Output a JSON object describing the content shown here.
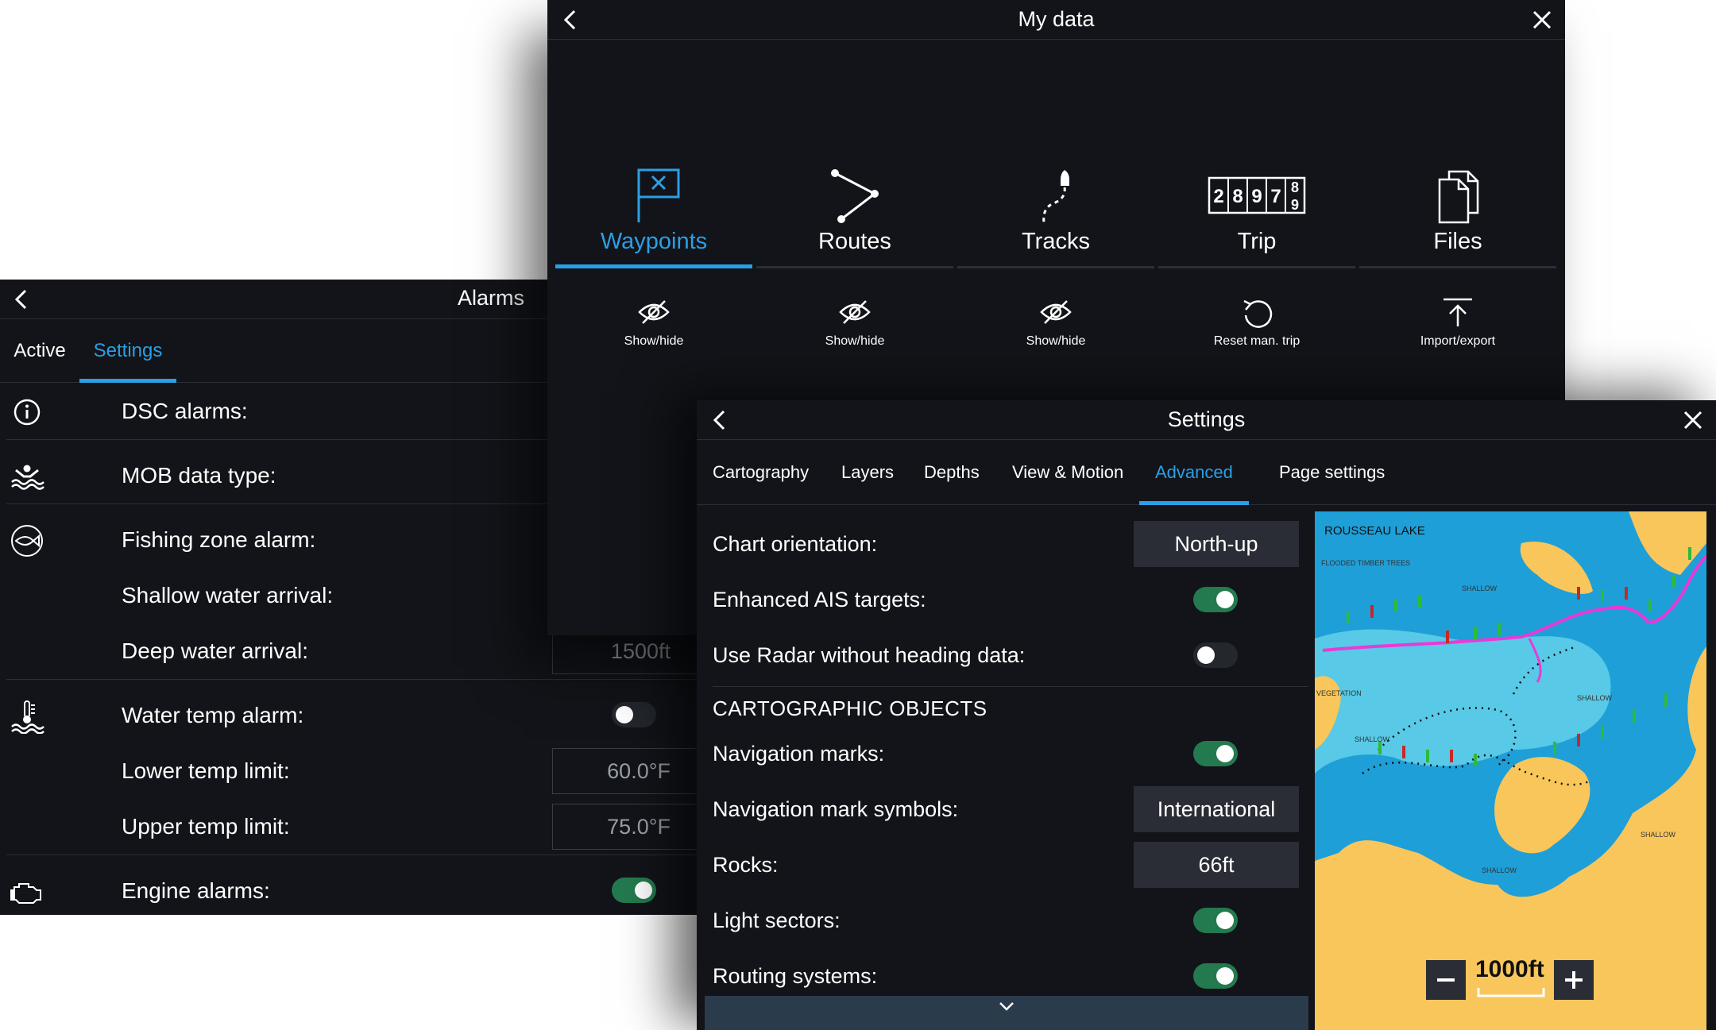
{
  "alarms": {
    "title": "Alarms",
    "tabs": [
      {
        "label": "Active"
      },
      {
        "label": "Settings"
      }
    ],
    "rows": {
      "dsc": "DSC alarms:",
      "mob": "MOB data type:",
      "fishing": "Fishing zone alarm:",
      "shallow": "Shallow water arrival:",
      "deep": "Deep water arrival:",
      "deep_value": "1500ft",
      "water_temp": "Water temp alarm:",
      "lower": "Lower temp limit:",
      "lower_value": "60.0°F",
      "upper": "Upper temp limit:",
      "upper_value": "75.0°F",
      "engine": "Engine alarms:"
    },
    "toggles": {
      "water_temp": false,
      "engine": true
    }
  },
  "mydata": {
    "title": "My data",
    "tabs": [
      {
        "label": "Waypoints",
        "icon": "waypoint-flag-icon"
      },
      {
        "label": "Routes",
        "icon": "route-icon"
      },
      {
        "label": "Tracks",
        "icon": "track-icon"
      },
      {
        "label": "Trip",
        "icon": "trip-counter-icon"
      },
      {
        "label": "Files",
        "icon": "files-icon"
      }
    ],
    "trip_digits": [
      "2",
      "8",
      "9",
      "7",
      "8",
      "9"
    ],
    "actions": [
      {
        "label": "Show/hide",
        "icon": "eye-hidden-icon"
      },
      {
        "label": "Show/hide",
        "icon": "eye-hidden-icon"
      },
      {
        "label": "Show/hide",
        "icon": "eye-hidden-icon"
      },
      {
        "label": "Reset man. trip",
        "icon": "reset-icon"
      },
      {
        "label": "Import/export",
        "icon": "upload-icon"
      }
    ]
  },
  "settings": {
    "title": "Settings",
    "tabs": [
      {
        "label": "Cartography"
      },
      {
        "label": "Layers"
      },
      {
        "label": "Depths"
      },
      {
        "label": "View & Motion"
      },
      {
        "label": "Advanced"
      },
      {
        "label": "Page settings"
      }
    ],
    "rows": {
      "orientation": "Chart orientation:",
      "orientation_value": "North-up",
      "ais": "Enhanced AIS targets:",
      "radar": "Use Radar without heading data:",
      "section": "CARTOGRAPHIC OBJECTS",
      "nav_marks": "Navigation marks:",
      "nav_symbols": "Navigation mark symbols:",
      "nav_symbols_value": "International",
      "rocks": "Rocks:",
      "rocks_value": "66ft",
      "light": "Light sectors:",
      "routing": "Routing systems:"
    },
    "toggles": {
      "ais": true,
      "radar": false,
      "nav_marks": true,
      "light": true,
      "routing": true
    },
    "map": {
      "label_lake": "ROUSSEAU LAKE",
      "label_flooded": "FLOODED TIMBER TREES",
      "label_shallow": "SHALLOW",
      "label_vegetation": "VEGETATION",
      "scale": "1000ft",
      "colors": {
        "land": "#f8c65a",
        "deep": "#1e9fd8",
        "shallow": "#58c9e6",
        "route": "#e83ad6"
      }
    }
  }
}
